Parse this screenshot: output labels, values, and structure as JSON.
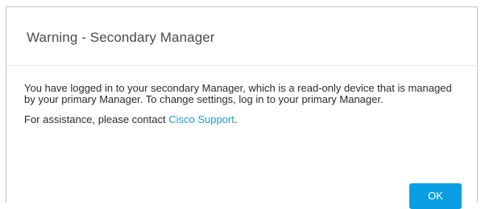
{
  "dialog": {
    "title": "Warning - Secondary Manager",
    "message": "You have logged in to your secondary Manager, which is a read-only device that is managed by your primary Manager. To change settings, log in to your primary Manager.",
    "assistance_prefix": "For assistance, please contact ",
    "support_link": "Cisco Support",
    "assistance_suffix": ".",
    "ok_label": "OK"
  },
  "colors": {
    "accent": "#0a9fe3",
    "link": "#1a9fd8"
  }
}
